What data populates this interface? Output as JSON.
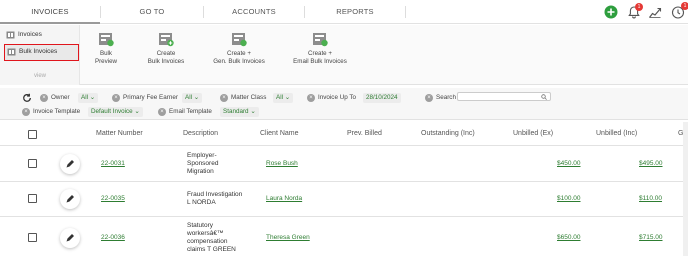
{
  "nav": {
    "tabs": [
      {
        "label": "INVOICES"
      },
      {
        "label": "GO TO"
      },
      {
        "label": "ACCOUNTS"
      },
      {
        "label": "REPORTS"
      }
    ],
    "notification_count": "1",
    "timer_count": "1"
  },
  "sidebar": {
    "items": [
      {
        "label": "Invoices"
      },
      {
        "label": "Bulk Invoices"
      }
    ],
    "view_label": "view"
  },
  "ribbon": {
    "buttons": [
      {
        "label_1": "Bulk",
        "label_2": "Preview"
      },
      {
        "label_1": "Create",
        "label_2": "Bulk Invoices"
      },
      {
        "label_1": "Create +",
        "label_2": "Gen. Bulk Invoices"
      },
      {
        "label_1": "Create +",
        "label_2": "Email Bulk Invoices"
      }
    ]
  },
  "filters": {
    "owner": {
      "label": "Owner",
      "value": "All"
    },
    "fee_earner": {
      "label": "Primary Fee Earner",
      "value": "All"
    },
    "matter_class": {
      "label": "Matter Class",
      "value": "All"
    },
    "invoice_up_to": {
      "label": "Invoice Up To",
      "value": "28/10/2024"
    },
    "search": {
      "label": "Search",
      "value": ""
    },
    "invoice_template": {
      "label": "Invoice Template",
      "value": "Default Invoice"
    },
    "email_template": {
      "label": "Email Template",
      "value": "Standard"
    }
  },
  "table": {
    "columns": [
      "Matter Number",
      "Description",
      "Client Name",
      "Prev. Billed",
      "Outstanding (Inc)",
      "Unbilled (Ex)",
      "Unbilled (Inc)",
      "GS"
    ],
    "rows": [
      {
        "matter": "22-0031",
        "description": [
          "Employer-",
          "Sponsored",
          "Migration"
        ],
        "client": "Rose Bush",
        "prev_billed": "",
        "outstanding": "",
        "unbilled_ex": "$450.00",
        "unbilled_inc": "$495.00"
      },
      {
        "matter": "22-0035",
        "description": [
          "Fraud Investigation",
          "L NORDA"
        ],
        "client": "Laura Norda",
        "prev_billed": "",
        "outstanding": "",
        "unbilled_ex": "$100.00",
        "unbilled_inc": "$110.00"
      },
      {
        "matter": "22-0036",
        "description": [
          "Statutory",
          "workersâ€™",
          "compensation",
          "claims T GREEN"
        ],
        "client": "Theresa Green",
        "prev_billed": "",
        "outstanding": "",
        "unbilled_ex": "$650.00",
        "unbilled_inc": "$715.00"
      }
    ]
  },
  "colors": {
    "accent_green": "#2e7d32",
    "highlight_red": "#e0151c",
    "badge_red": "#e53935"
  }
}
